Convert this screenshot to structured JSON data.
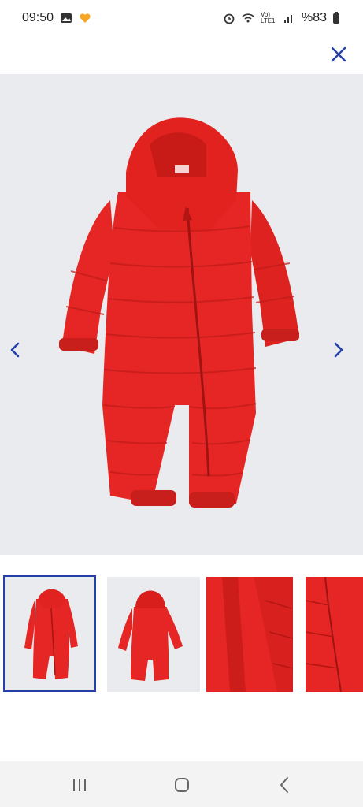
{
  "status_bar": {
    "time": "09:50",
    "battery": "%83",
    "network": "Vo) LTE1"
  },
  "header": {
    "close_icon": "close-icon"
  },
  "gallery": {
    "main_image": "red-puffer-snowsuit-front",
    "prev_icon": "chevron-left-icon",
    "next_icon": "chevron-right-icon",
    "thumbnails": [
      {
        "view": "front",
        "active": true
      },
      {
        "view": "back",
        "active": false
      },
      {
        "view": "inside-open-detail",
        "active": false
      },
      {
        "view": "zipper-detail",
        "active": false
      }
    ]
  },
  "colors": {
    "accent": "#2541a8",
    "product": "#e52624",
    "background": "#e9ebee"
  },
  "nav_bar": {
    "recents_icon": "recents-icon",
    "home_icon": "home-icon",
    "back_icon": "back-icon"
  }
}
